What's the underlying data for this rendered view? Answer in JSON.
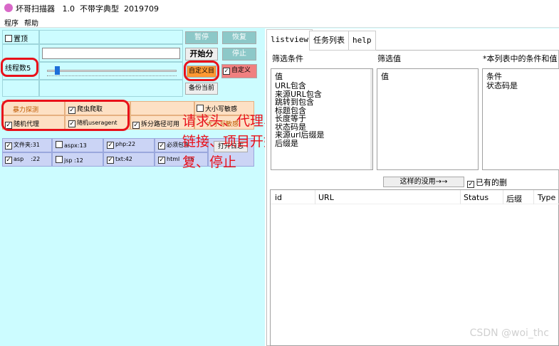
{
  "window": {
    "title": "坏哥扫描器   1.0  不带字典型  2019709"
  },
  "menu": [
    "程序",
    "帮助"
  ],
  "left": {
    "pin_label": "置顶",
    "threads_label": "线程数5",
    "buttons": {
      "pause": "暂停",
      "resume": "恢复",
      "start": "开始分",
      "stop": "停止",
      "custom_dir": "自定义目",
      "backup": "备份当前"
    },
    "custom_check": "自定义",
    "options": {
      "brute": "暴力探测",
      "crawl": "爬虫爬取",
      "case": "大小写敏感",
      "random_proxy": "随机代理",
      "random_ua": "随机useragent",
      "split_path": "拆分路径可用",
      "case2": "大小写敏感"
    },
    "dicts": {
      "row1": [
        "文件夹:31",
        "aspx:13",
        "php:22",
        "必须包含"
      ],
      "row2": [
        "asp    :22",
        "jsp :12",
        "txt:42",
        "html   :16"
      ],
      "open": "打开日志"
    }
  },
  "annotation": "请求头、代理、爬取\n链接、项目开始、恢\n复、停止",
  "right": {
    "tabs": [
      "listview",
      "任务列表",
      "help"
    ],
    "headers": {
      "filter_cond": "筛选条件",
      "filter_val": "筛选值",
      "note": "*本列表中的条件和值"
    },
    "cond_list": [
      "值",
      "URL包含",
      "来源URL包含",
      "跳转到包含",
      "标题包含",
      "长度等于",
      "状态码是",
      "来源url后缀是",
      "后缀是"
    ],
    "val_list": [
      "值"
    ],
    "cond_list2": [
      "条件",
      "状态码是"
    ],
    "apply_btn": "这样的没用→→",
    "existing_check": "已有的删",
    "table_columns": [
      "id",
      "URL",
      "Status",
      "后缀",
      "Type"
    ]
  },
  "watermark": "CSDN @woi_thc"
}
